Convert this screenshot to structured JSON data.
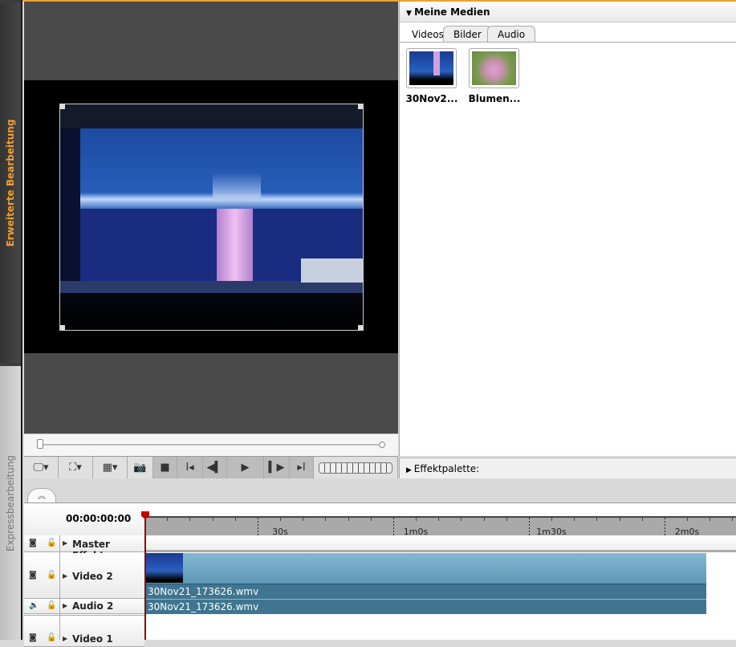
{
  "sidebar": {
    "tab_advanced": "Erweiterte Bearbeitung",
    "tab_express": "Expressbearbeitung"
  },
  "media": {
    "title": "Meine Medien",
    "tabs": [
      "Videos",
      "Bilder",
      "Audio"
    ],
    "active_tab": "Videos",
    "items": [
      {
        "label": "30Nov2..."
      },
      {
        "label": "Blumen..."
      }
    ]
  },
  "effects": {
    "title": "Effektpalette:"
  },
  "toolbar": {
    "icons": [
      "monitor-icon",
      "fullscreen-icon",
      "layout-icon",
      "snapshot-icon",
      "stop-icon",
      "mark-in-icon",
      "prev-frame-icon",
      "play-icon",
      "next-frame-icon",
      "mark-out-icon",
      "jog-wheel"
    ]
  },
  "timeline": {
    "timecode": "00:00:00:00",
    "ruler": [
      "30s",
      "1m0s",
      "1m30s",
      "2m0s"
    ],
    "tracks": [
      {
        "name": "Master Effekte"
      },
      {
        "name": "Video 2",
        "clip": "30Nov21_173626.wmv"
      },
      {
        "name": "Audio 2",
        "clip": "30Nov21_173626.wmv"
      },
      {
        "name": "Video 1"
      }
    ]
  },
  "colors": {
    "accent": "#f0a030",
    "clip": "#3f7590",
    "clip_top": "#7fb2cc",
    "playhead": "#c00000"
  }
}
